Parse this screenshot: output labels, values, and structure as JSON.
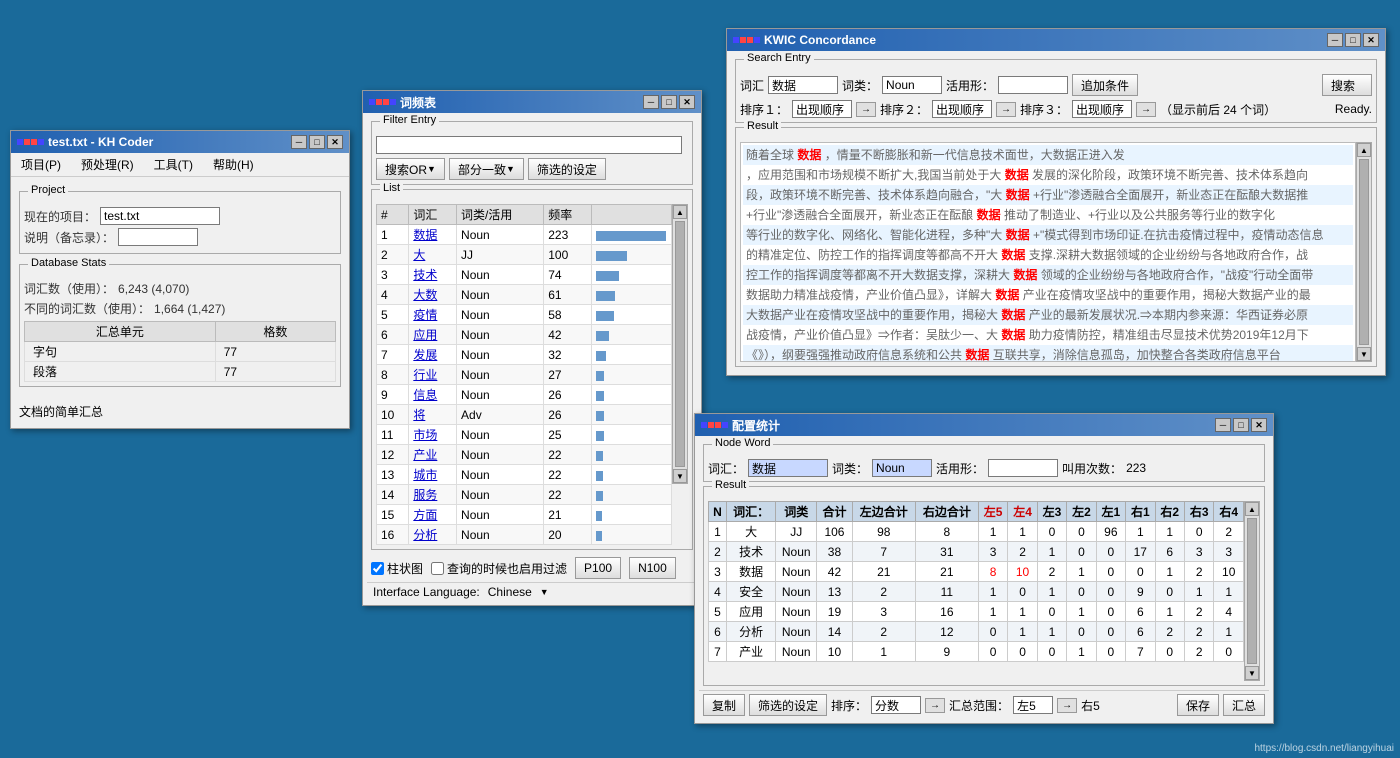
{
  "main_window": {
    "title": "test.txt - KH Coder",
    "menus": [
      "项目(P)",
      "预处理(R)",
      "工具(T)",
      "帮助(H)"
    ],
    "project_label": "Project",
    "current_project_label": "现在的项目：",
    "current_project_value": "test.txt",
    "notes_label": "说明（备忘录）：",
    "notes_value": "",
    "db_stats_label": "Database Stats",
    "vocab_label": "词汇数（使用）：",
    "vocab_value": "6,243 (4,070)",
    "unique_vocab_label": "不同的词汇数（使用）：",
    "unique_vocab_value": "1,664 (1,427)",
    "table_headers": [
      "汇总单元",
      "格数"
    ],
    "table_rows": [
      {
        "unit": "字句",
        "count": "77"
      },
      {
        "unit": "段落",
        "count": "77"
      }
    ],
    "summary_label": "文档的简单汇总"
  },
  "freq_window": {
    "title": "词频表",
    "filter_label": "Filter Entry",
    "filter_value": "",
    "btn_or": "搜索OR",
    "btn_partial": "部分一致",
    "btn_filter": "筛选的设定",
    "list_label": "List",
    "col_num": "#",
    "col_word": "词汇",
    "col_type": "词类/活用",
    "col_freq": "频率",
    "rows": [
      {
        "n": "1",
        "word": "数据",
        "type": "Noun",
        "freq": "223",
        "bar": 100
      },
      {
        "n": "2",
        "word": "大",
        "type": "JJ",
        "freq": "100",
        "bar": 45
      },
      {
        "n": "3",
        "word": "技术",
        "type": "Noun",
        "freq": "74",
        "bar": 33
      },
      {
        "n": "4",
        "word": "大数",
        "type": "Noun",
        "freq": "61",
        "bar": 27
      },
      {
        "n": "5",
        "word": "疫情",
        "type": "Noun",
        "freq": "58",
        "bar": 26
      },
      {
        "n": "6",
        "word": "应用",
        "type": "Noun",
        "freq": "42",
        "bar": 19
      },
      {
        "n": "7",
        "word": "发展",
        "type": "Noun",
        "freq": "32",
        "bar": 14
      },
      {
        "n": "8",
        "word": "行业",
        "type": "Noun",
        "freq": "27",
        "bar": 12
      },
      {
        "n": "9",
        "word": "信息",
        "type": "Noun",
        "freq": "26",
        "bar": 12
      },
      {
        "n": "10",
        "word": "将",
        "type": "Adv",
        "freq": "26",
        "bar": 12
      },
      {
        "n": "11",
        "word": "市场",
        "type": "Noun",
        "freq": "25",
        "bar": 11
      },
      {
        "n": "12",
        "word": "产业",
        "type": "Noun",
        "freq": "22",
        "bar": 10
      },
      {
        "n": "13",
        "word": "城市",
        "type": "Noun",
        "freq": "22",
        "bar": 10
      },
      {
        "n": "14",
        "word": "服务",
        "type": "Noun",
        "freq": "22",
        "bar": 10
      },
      {
        "n": "15",
        "word": "方面",
        "type": "Noun",
        "freq": "21",
        "bar": 9
      },
      {
        "n": "16",
        "word": "分析",
        "type": "Noun",
        "freq": "20",
        "bar": 9
      }
    ],
    "checkbox_bar": "柱状图",
    "checkbox_filter": "查询的时候也启用过滤",
    "btn_p100": "P100",
    "btn_n100": "N100",
    "interface_label": "Interface Language:",
    "interface_value": "Chinese"
  },
  "kwic_window": {
    "title": "KWIC Concordance",
    "search_label": "Search Entry",
    "word_label": "词汇",
    "word_value": "数据",
    "type_label": "词类：",
    "type_value": "Noun",
    "form_label": "活用形：",
    "form_value": "",
    "btn_add": "追加条件",
    "btn_search": "搜索",
    "sort1_label": "排序１：",
    "sort1_value": "出现顺序",
    "sort2_label": "排序２：",
    "sort2_value": "出现顺序",
    "sort3_label": "排序３：",
    "sort3_value": "出现顺序",
    "display_label": "（显示前后 24 个词）",
    "status": "Ready.",
    "result_label": "Result",
    "kwic_lines": [
      {
        "left": "随着全球",
        "keyword": "数据",
        "right": "，情量不断膨胀和新一代信息技术面世，大数据正进入发"
      },
      {
        "left": "，应用范围和市场规模不断扩大,我国当前处于大",
        "keyword": "数据",
        "right": "发展的深化阶段，政策环境不断完善、技术体系趋向"
      },
      {
        "left": "段，政策环境不断完善、技术体系趋向融合，\"大",
        "keyword": "数据",
        "right": "+行业\"渗透融合全面展开，新业态正在酝酿大数据推"
      },
      {
        "left": "+行业\"渗透融合全面展开，新业态正在酝酿",
        "keyword": "数据",
        "right": "推动了制造业、+行业以及公共服务等行业的数字化"
      },
      {
        "left": "等行业的数字化、网络化、智能化进程，多种\"大",
        "keyword": "数据",
        "right": "+\"模式得到市场印证.在抗击疫情过程中，疫情动态信息"
      },
      {
        "left": "的精准定位、防控工作的指挥调度等都高不开大",
        "keyword": "数据",
        "right": "支撑.深耕大数据领域的企业纷纷与各地政府合作，战"
      },
      {
        "left": "控工作的指挥调度等都离不开大数据支撑，深耕大",
        "keyword": "数据",
        "right": "领域的企业纷纷与各地政府合作，\"战疫\"行动全面带"
      },
      {
        "left": "数据助力精准战疫情，产业价值凸显》，详解大",
        "keyword": "数据",
        "right": "产业在疫情攻坚战中的重要作用，揭秘大数据产业的最"
      },
      {
        "left": "大数据产业在疫情攻坚战中的重要作用，揭秘大",
        "keyword": "数据",
        "right": "产业的最新发展状况.⇒本期内参来源：华西证券必原"
      },
      {
        "left": "战疫情，产业价值凸显》⇒作者：吴肽少一、大",
        "keyword": "数据",
        "right": "助力疫情防控，精准组击尽显技术优势2019年12月下"
      },
      {
        "left": "《》），纲要强强推动政府信息系统和公共",
        "keyword": "数据",
        "right": "互联共享，消除信息孤岛，加快整合各类政府信息平台"
      }
    ]
  },
  "stats_window": {
    "title": "配置统计",
    "node_word_label": "Node Word",
    "word_label": "词汇：",
    "word_value": "数据",
    "type_label": "词类：",
    "type_value": "Noun",
    "form_label": "活用形：",
    "form_value": "",
    "count_label": "叫用次数：",
    "count_value": "223",
    "result_label": "Result",
    "col_n": "N",
    "col_word": "词汇：",
    "col_type": "词类",
    "col_total": "合计",
    "col_left_total": "左边合计",
    "col_right_total": "右边合计",
    "col_l5": "左5",
    "col_l4": "左4",
    "col_l3": "左3",
    "col_l2": "左2",
    "col_l1": "左1",
    "col_r1": "右1",
    "col_r2": "右2",
    "col_r3": "右3",
    "col_r4": "右4",
    "rows": [
      {
        "n": "1",
        "word": "大",
        "type": "JJ",
        "total": "106",
        "left_total": "98",
        "right_total": "8",
        "l5": "1",
        "l4": "1",
        "l3": "0",
        "l2": "0",
        "l1": "96",
        "r1": "1",
        "r2": "1",
        "r3": "0",
        "r4": "2"
      },
      {
        "n": "2",
        "word": "技术",
        "type": "Noun",
        "total": "38",
        "left_total": "7",
        "right_total": "31",
        "l5": "3",
        "l4": "2",
        "l3": "1",
        "l2": "0",
        "l1": "0",
        "r1": "17",
        "r2": "6",
        "r3": "3",
        "r4": "3"
      },
      {
        "n": "3",
        "word": "数据",
        "type": "Noun",
        "total": "42",
        "left_total": "21",
        "right_total": "21",
        "l5": "8",
        "l4": "10",
        "l3": "2",
        "l2": "1",
        "l1": "0",
        "r1": "0",
        "r2": "1",
        "r3": "2",
        "r4": "10"
      },
      {
        "n": "4",
        "word": "安全",
        "type": "Noun",
        "total": "13",
        "left_total": "2",
        "right_total": "11",
        "l5": "1",
        "l4": "0",
        "l3": "1",
        "l2": "0",
        "l1": "0",
        "r1": "9",
        "r2": "0",
        "r3": "1",
        "r4": "1"
      },
      {
        "n": "5",
        "word": "应用",
        "type": "Noun",
        "total": "19",
        "left_total": "3",
        "right_total": "16",
        "l5": "1",
        "l4": "1",
        "l3": "0",
        "l2": "1",
        "l1": "0",
        "r1": "6",
        "r2": "1",
        "r3": "2",
        "r4": "4"
      },
      {
        "n": "6",
        "word": "分析",
        "type": "Noun",
        "total": "14",
        "left_total": "2",
        "right_total": "12",
        "l5": "0",
        "l4": "1",
        "l3": "1",
        "l2": "0",
        "l1": "0",
        "r1": "6",
        "r2": "2",
        "r3": "2",
        "r4": "1"
      },
      {
        "n": "7",
        "word": "产业",
        "type": "Noun",
        "total": "10",
        "left_total": "1",
        "right_total": "9",
        "l5": "0",
        "l4": "0",
        "l3": "0",
        "l2": "1",
        "l1": "0",
        "r1": "7",
        "r2": "0",
        "r3": "2",
        "r4": "0"
      }
    ],
    "btn_copy": "复制",
    "btn_filter": "筛选的设定",
    "sort_label": "排序：",
    "sort_value": "分数",
    "total_range_label": "汇总范围：",
    "total_range_value": "左5",
    "right_label": "右5",
    "btn_save": "保存",
    "btn_summary": "汇总"
  },
  "watermark": "https://blog.csdn.net/liangyihuai"
}
